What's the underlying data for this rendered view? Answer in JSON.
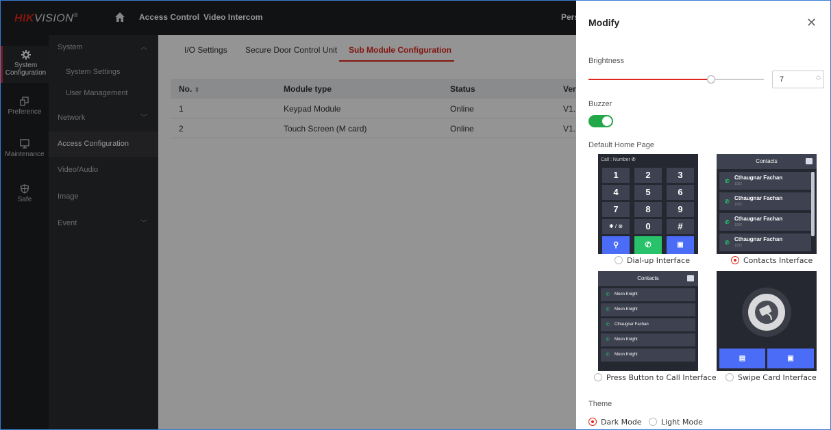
{
  "brand": {
    "logo_hik": "HIK",
    "logo_vision": "VISION",
    "logo_reg": "®"
  },
  "topbar": {
    "nav": [
      "Access Control",
      "Video Intercom"
    ],
    "person": "Person"
  },
  "rail": [
    {
      "label_1": "System",
      "label_2": "Configuration",
      "icon": "gear-icon"
    },
    {
      "label_1": "Preference",
      "icon": "preference-icon"
    },
    {
      "label_1": "Maintenance",
      "icon": "monitor-icon"
    },
    {
      "label_1": "Safe",
      "icon": "shield-icon"
    }
  ],
  "subnav": [
    {
      "label": "System"
    },
    {
      "label": "System Settings"
    },
    {
      "label": "User Management"
    },
    {
      "label": "Network"
    },
    {
      "label": "Access Configuration"
    },
    {
      "label": "Video/Audio"
    },
    {
      "label": "Image"
    },
    {
      "label": "Event"
    }
  ],
  "tabs": [
    "I/O Settings",
    "Secure Door Control Unit",
    "Sub Module Configuration"
  ],
  "table": {
    "headers": [
      "No.",
      "Module type",
      "Status",
      "Ver"
    ],
    "rows": [
      [
        "1",
        "Keypad Module",
        "Online",
        "V1."
      ],
      [
        "2",
        "Touch Screen (M card)",
        "Online",
        "V1."
      ]
    ]
  },
  "panel": {
    "title": "Modify",
    "close": "✕",
    "brightness_label": "Brightness",
    "brightness_value": "7",
    "brightness_fraction": 0.7,
    "buzzer_label": "Buzzer",
    "buzzer_on": true,
    "home_label": "Default Home Page",
    "options": [
      {
        "label": "Dial-up Interface",
        "selected": false
      },
      {
        "label": "Contacts Interface",
        "selected": true
      },
      {
        "label": "Press Button to Call Interface",
        "selected": false
      },
      {
        "label": "Swipe Card Interface",
        "selected": false
      }
    ],
    "theme_label": "Theme",
    "themes": [
      {
        "label": "Dark Mode",
        "selected": true
      },
      {
        "label": "Light Mode",
        "selected": false
      }
    ]
  },
  "dialer": {
    "head": "Call : Number",
    "keys": [
      "1",
      "2",
      "3",
      "4",
      "5",
      "6",
      "7",
      "8",
      "9",
      "✱ / ⊗",
      "0",
      "#"
    ]
  },
  "contacts_thumb": {
    "title": "Contacts",
    "rows": [
      {
        "name": "Cthaugnar Fachan",
        "sub": "1002"
      },
      {
        "name": "Cthaugnar Fachan",
        "sub": "1002"
      },
      {
        "name": "Cthaugnar Fachan",
        "sub": "1002"
      },
      {
        "name": "Cthaugnar Fachan",
        "sub": "1002"
      }
    ]
  },
  "press_thumb": {
    "title": "Contacts",
    "rows": [
      "Moon Knight",
      "Moon Knight",
      "Cthaugnar Fachan",
      "Moon Knight",
      "Moon Knight"
    ]
  },
  "colors": {
    "accent": "#e0271c",
    "toggle": "#23a849",
    "thumb_bg": "#262831",
    "key_blue": "#4a6cf7",
    "key_green": "#27c26a"
  }
}
